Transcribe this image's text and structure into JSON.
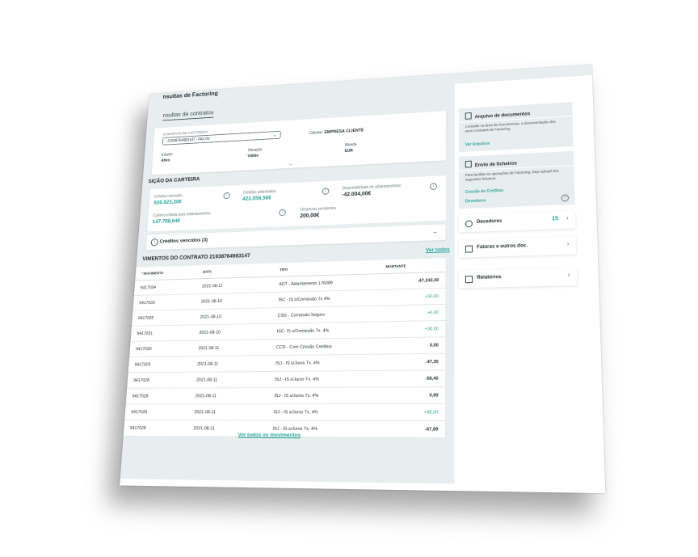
{
  "page": {
    "title": "nsultas de Factoring",
    "tab": "nsultas de contratos"
  },
  "contract": {
    "select_label": "CONTRATO DE FACTORING",
    "select_value": "21938764983147 - FAC/SI",
    "client_label": "Cliente:",
    "client_value": "EMPRESA CLIENTE",
    "estado_label": "Estado",
    "estado_value": "Ativo",
    "situacao_label": "Situação",
    "situacao_value": "Válido",
    "moeda_label": "Moeda",
    "moeda_value": "EUR"
  },
  "portfolio": {
    "title": "SIÇÃO DA CARTEIRA",
    "kpis": [
      {
        "label": "Créditos tomados",
        "value": "528.823,20€"
      },
      {
        "label": "Créditos adiantados",
        "value": "423.058,56€"
      },
      {
        "label": "Disponibilidade de adiantamentos:",
        "value": "-42.004,00€"
      },
      {
        "label": "Carteira imbida para adiantamentos",
        "value": "147.768,64€"
      },
      {
        "label": "Despesas pendentes",
        "value": "200,00€"
      }
    ],
    "overdue_label": "Créditos vencidos (3)"
  },
  "movements": {
    "title": "VIMENTOS DO CONTRATO 21938764983147",
    "see_all_link": "Ver todos",
    "columns": [
      "º MOVIMENTO",
      "DATA",
      "TIPO",
      "MONTANTE"
    ],
    "rows": [
      {
        "num": "9417034",
        "date": "2021-08-11",
        "type": "ADT - Adiantamento 176389",
        "amount": "-47.243,00",
        "positive": false
      },
      {
        "num": "9417033",
        "date": "2021-08-10",
        "type": "ISC - IS s/Comissão Tx 4%",
        "amount": "+50,60",
        "positive": true
      },
      {
        "num": "9417032",
        "date": "2021-08-10",
        "type": "CSG - Comissão Seguro",
        "amount": "+6,60",
        "positive": true
      },
      {
        "num": "9417031",
        "date": "2021-08-10",
        "type": "ISC- IS s/Comissão Tx. 4%",
        "amount": "+30,60",
        "positive": true
      },
      {
        "num": "9417030",
        "date": "2021-08-11",
        "type": "CCD - Com Cessão Créditos",
        "amount": "0,00",
        "positive": false
      },
      {
        "num": "9417029",
        "date": "2021-08-11",
        "type": "ISJ - IS s/Juros Tx. 4%",
        "amount": "-47,30",
        "positive": false
      },
      {
        "num": "9417028",
        "date": "2021-08-11",
        "type": "ISJ - IS s/Juros Tx. 4%",
        "amount": "-56,40",
        "positive": false
      },
      {
        "num": "9417028",
        "date": "2021-08-11",
        "type": "ISJ - IS s/Juros Tx. 4%",
        "amount": "0,00",
        "positive": false
      },
      {
        "num": "9417028",
        "date": "2021-08-11",
        "type": "ISJ - IS s/Juros Tx. 4%",
        "amount": "+48,00",
        "positive": true
      },
      {
        "num": "9417028",
        "date": "2021-08-11",
        "type": "ISJ - IS s/Juros Tx. 4%",
        "amount": "-67,69",
        "positive": false
      }
    ],
    "see_all_movements": "Ver todos os movimentos"
  },
  "sidebar": {
    "documents": {
      "title": "Arquivo de documentos",
      "desc": "Consulte na área de Documentos, a documentação dos seus contratos de Factoring.",
      "link": "Ver Arquivos"
    },
    "upload": {
      "title": "Envio de ficheiros",
      "desc": "Para facilitar as operações de Factoring, faça upload dos seguintes ficheiros.",
      "link1": "Cessão de Créditos",
      "link2": "Devedores"
    },
    "nav": [
      {
        "label": "Devedores",
        "count": "15"
      },
      {
        "label": "Faturas e outros doc.",
        "count": ""
      },
      {
        "label": "Relatórios",
        "count": ""
      }
    ]
  }
}
